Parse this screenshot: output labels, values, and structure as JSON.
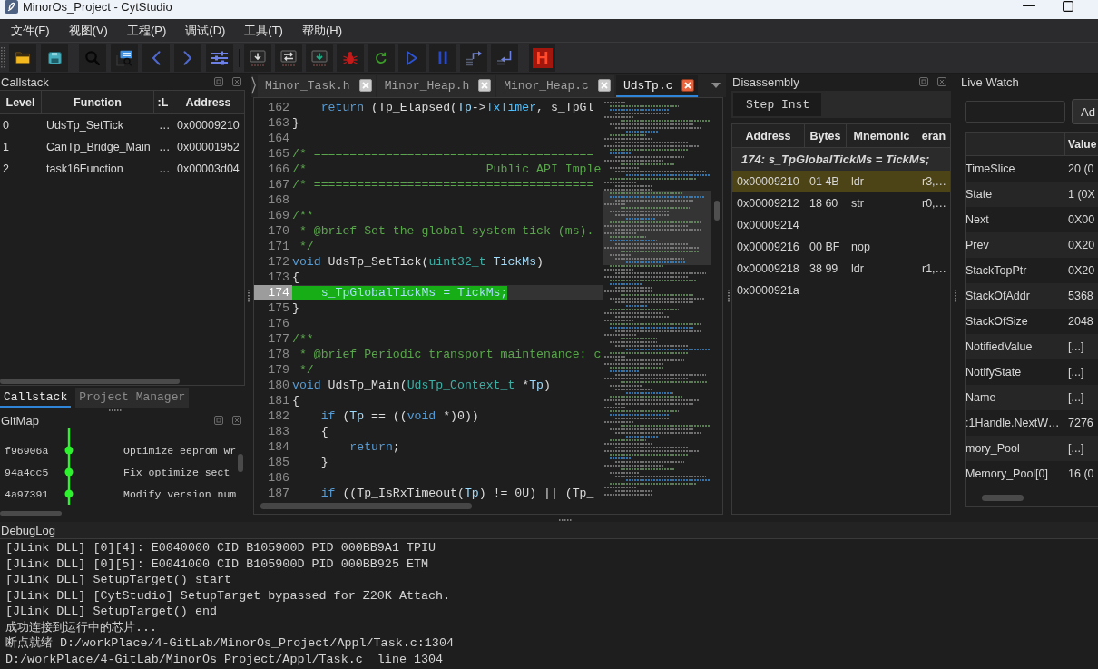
{
  "window": {
    "title": "MinorOs_Project - CytStudio"
  },
  "menu": [
    "文件(F)",
    "视图(V)",
    "工程(P)",
    "调试(D)",
    "工具(T)",
    "帮助(H)"
  ],
  "toolbar": {
    "letter_button": "H"
  },
  "callstack": {
    "title": "Callstack",
    "columns": [
      "Level",
      "Function",
      ":L",
      "Address"
    ],
    "rows": [
      {
        "level": "0",
        "function": "UdsTp_SetTick",
        "column_3": "…",
        "address": "0x00009210"
      },
      {
        "level": "1",
        "function": "CanTp_Bridge_Main",
        "column_3": "…",
        "address": "0x00001952"
      },
      {
        "level": "2",
        "function": "task16Function",
        "column_3": "…",
        "address": "0x00003d04"
      }
    ],
    "tabs": [
      {
        "label": "Callstack",
        "selected": true
      },
      {
        "label": "Project Manager",
        "selected": false
      }
    ]
  },
  "gitmap": {
    "title": "GitMap",
    "commits": [
      {
        "hash": "f96906a",
        "message": "Optimize eeprom wr"
      },
      {
        "hash": "94a4cc5",
        "message": "Fix optimize sect"
      },
      {
        "hash": "4a97391",
        "message": "Modify version num"
      }
    ]
  },
  "editor": {
    "tabs": [
      {
        "label": "Minor_Task.h",
        "selected": false
      },
      {
        "label": "Minor_Heap.h",
        "selected": false
      },
      {
        "label": "Minor_Heap.c",
        "selected": false
      },
      {
        "label": "UdsTp.c",
        "selected": true
      }
    ],
    "lines": [
      {
        "number": "162",
        "current": false,
        "tokens": [
          {
            "kind": "keyword",
            "text": "    return"
          },
          {
            "kind": "plain",
            "text": " (Tp_Elapsed("
          },
          {
            "kind": "param",
            "text": "Tp"
          },
          {
            "kind": "plain",
            "text": "->"
          },
          {
            "kind": "member",
            "text": "TxTimer"
          },
          {
            "kind": "plain",
            "text": ", s_TpGl"
          }
        ]
      },
      {
        "number": "163",
        "current": false,
        "tokens": [
          {
            "kind": "plain",
            "text": "}"
          }
        ]
      },
      {
        "number": "164",
        "current": false
      },
      {
        "number": "165",
        "current": false,
        "tokens": [
          {
            "kind": "comment",
            "text": "/* ======================================="
          }
        ]
      },
      {
        "number": "166",
        "current": false,
        "tokens": [
          {
            "kind": "comment",
            "text": "/*                         Public API Imple"
          }
        ]
      },
      {
        "number": "167",
        "current": false,
        "tokens": [
          {
            "kind": "comment",
            "text": "/* ======================================="
          }
        ]
      },
      {
        "number": "168",
        "current": false
      },
      {
        "number": "169",
        "current": false,
        "tokens": [
          {
            "kind": "comment",
            "text": "/**"
          }
        ]
      },
      {
        "number": "170",
        "current": false,
        "tokens": [
          {
            "kind": "comment",
            "text": " * @brief Set the global system tick (ms)."
          }
        ]
      },
      {
        "number": "171",
        "current": false,
        "tokens": [
          {
            "kind": "comment",
            "text": " */"
          }
        ]
      },
      {
        "number": "172",
        "current": false,
        "tokens": [
          {
            "kind": "keyword",
            "text": "void"
          },
          {
            "kind": "plain",
            "text": " UdsTp_SetTick("
          },
          {
            "kind": "type",
            "text": "uint32_t"
          },
          {
            "kind": "param",
            "text": " TickMs"
          },
          {
            "kind": "plain",
            "text": ")"
          }
        ]
      },
      {
        "number": "173",
        "current": false,
        "tokens": [
          {
            "kind": "plain",
            "text": "{"
          }
        ]
      },
      {
        "number": "174",
        "current": true,
        "tokens": [
          {
            "kind": "plain",
            "text": "    s_TpGlobalTickMs = "
          },
          {
            "kind": "param",
            "text": "TickMs"
          },
          {
            "kind": "plain",
            "text": ";"
          }
        ]
      },
      {
        "number": "175",
        "current": false,
        "tokens": [
          {
            "kind": "plain",
            "text": "}"
          }
        ]
      },
      {
        "number": "176",
        "current": false
      },
      {
        "number": "177",
        "current": false,
        "tokens": [
          {
            "kind": "comment",
            "text": "/**"
          }
        ]
      },
      {
        "number": "178",
        "current": false,
        "tokens": [
          {
            "kind": "comment",
            "text": " * @brief Periodic transport maintenance: c"
          }
        ]
      },
      {
        "number": "179",
        "current": false,
        "tokens": [
          {
            "kind": "comment",
            "text": " */"
          }
        ]
      },
      {
        "number": "180",
        "current": false,
        "tokens": [
          {
            "kind": "keyword",
            "text": "void"
          },
          {
            "kind": "plain",
            "text": " UdsTp_Main("
          },
          {
            "kind": "type",
            "text": "UdsTp_Context_t"
          },
          {
            "kind": "plain",
            "text": " *"
          },
          {
            "kind": "param",
            "text": "Tp"
          },
          {
            "kind": "plain",
            "text": ")"
          }
        ]
      },
      {
        "number": "181",
        "current": false,
        "tokens": [
          {
            "kind": "plain",
            "text": "{"
          }
        ]
      },
      {
        "number": "182",
        "current": false,
        "tokens": [
          {
            "kind": "keyword",
            "text": "    if"
          },
          {
            "kind": "plain",
            "text": " ("
          },
          {
            "kind": "param",
            "text": "Tp"
          },
          {
            "kind": "plain",
            "text": " == (("
          },
          {
            "kind": "keyword",
            "text": "void"
          },
          {
            "kind": "plain",
            "text": " *)0))"
          }
        ]
      },
      {
        "number": "183",
        "current": false,
        "tokens": [
          {
            "kind": "plain",
            "text": "    {"
          }
        ]
      },
      {
        "number": "184",
        "current": false,
        "tokens": [
          {
            "kind": "keyword",
            "text": "        return"
          },
          {
            "kind": "plain",
            "text": ";"
          }
        ]
      },
      {
        "number": "185",
        "current": false,
        "tokens": [
          {
            "kind": "plain",
            "text": "    }"
          }
        ]
      },
      {
        "number": "186",
        "current": false
      },
      {
        "number": "187",
        "current": false,
        "tokens": [
          {
            "kind": "keyword",
            "text": "    if"
          },
          {
            "kind": "plain",
            "text": " ((Tp_IsRxTimeout("
          },
          {
            "kind": "param",
            "text": "Tp"
          },
          {
            "kind": "plain",
            "text": ") != 0U) || (Tp_"
          }
        ]
      }
    ]
  },
  "disassembly": {
    "title": "Disassembly",
    "step_button": "Step Inst",
    "columns": [
      "Address",
      "Bytes",
      "Mnemonic",
      "eran"
    ],
    "source_line": "174:  s_TpGlobalTickMs = TickMs;",
    "rows": [
      {
        "address": "0x00009210",
        "bytes": "01 4B",
        "mnemonic": "ldr",
        "column_4": "r3,…",
        "selected": true
      },
      {
        "address": "0x00009212",
        "bytes": "18 60",
        "mnemonic": "str",
        "column_4": "r0,…",
        "selected": false
      },
      {
        "address": "0x00009214",
        "selected": false
      },
      {
        "address": "0x00009216",
        "bytes": "00 BF",
        "mnemonic": "nop",
        "selected": false
      },
      {
        "address": "0x00009218",
        "bytes": "38 99",
        "mnemonic": "ldr",
        "column_4": "r1,…",
        "selected": false
      },
      {
        "address": "0x0000921a",
        "selected": false
      }
    ]
  },
  "live_watch": {
    "title": "Live Watch",
    "add_button": "Ad",
    "value_column": "Value",
    "rows": [
      {
        "name": "TimeSlice",
        "value": "20 (0"
      },
      {
        "name": "State",
        "value": "1 (0X"
      },
      {
        "name": "Next",
        "value": "0X00"
      },
      {
        "name": "Prev",
        "value": "0X20"
      },
      {
        "name": "StackTopPtr",
        "value": "0X20"
      },
      {
        "name": "StackOfAddr",
        "value": "5368"
      },
      {
        "name": "StackOfSize",
        "value": "2048"
      },
      {
        "name": "NotifiedValue",
        "value": "[...]"
      },
      {
        "name": "NotifyState",
        "value": "[...]"
      },
      {
        "name": "Name",
        "value": "[...]"
      },
      {
        "name": ":1Handle.NextW…",
        "value": "7276"
      },
      {
        "name": "mory_Pool",
        "value": "[...]"
      },
      {
        "name": "Memory_Pool[0]",
        "value": "16 (0"
      }
    ]
  },
  "debug_log": {
    "title": "DebugLog",
    "lines": [
      "[JLink DLL] [0][4]: E0040000 CID B105900D PID 000BB9A1 TPIU",
      "[JLink DLL] [0][5]: E0041000 CID B105900D PID 000BB925 ETM",
      "[JLink DLL] SetupTarget() start",
      "[JLink DLL] [CytStudio] SetupTarget bypassed for Z20K Attach.",
      "[JLink DLL] SetupTarget() end",
      "成功连接到运行中的芯片...",
      "断点就绪 D:/workPlace/4-GitLab/MinorOs_Project/Appl/Task.c:1304",
      "D:/workPlace/4-GitLab/MinorOs_Project/Appl/Task.c  line 1304"
    ]
  }
}
